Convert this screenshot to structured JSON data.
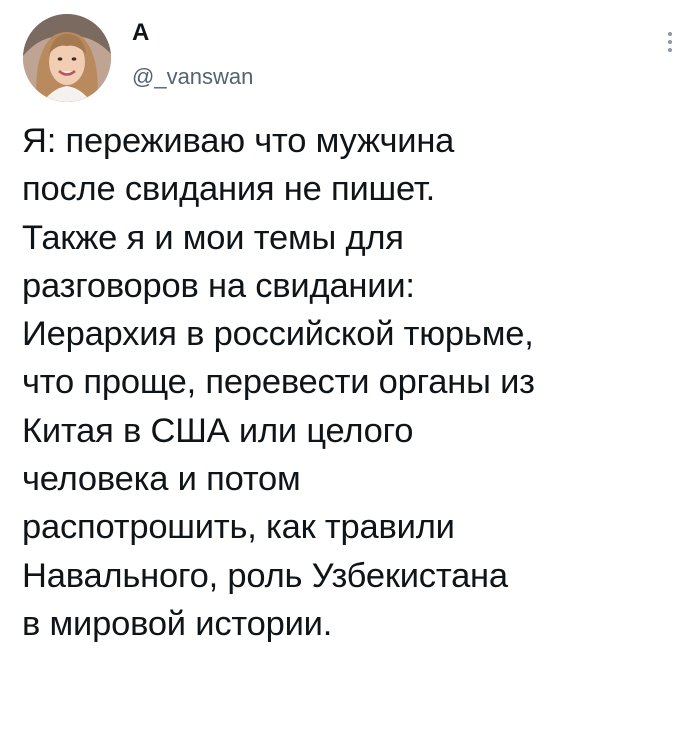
{
  "tweet": {
    "display_name": "А",
    "username": "@_vanswan",
    "lines": [
      "Я: переживаю что мужчина",
      "после свидания не пишет.",
      "Также я и мои темы для",
      "разговоров на свидании:",
      "Иерархия в российской тюрьме,",
      "что проще, перевести органы из",
      "Китая в США или целого",
      "человека и потом",
      "распотрошить, как травили",
      "Навального, роль Узбекистана",
      "в мировой истории."
    ]
  },
  "icons": {
    "more": "more-vertical-icon"
  }
}
